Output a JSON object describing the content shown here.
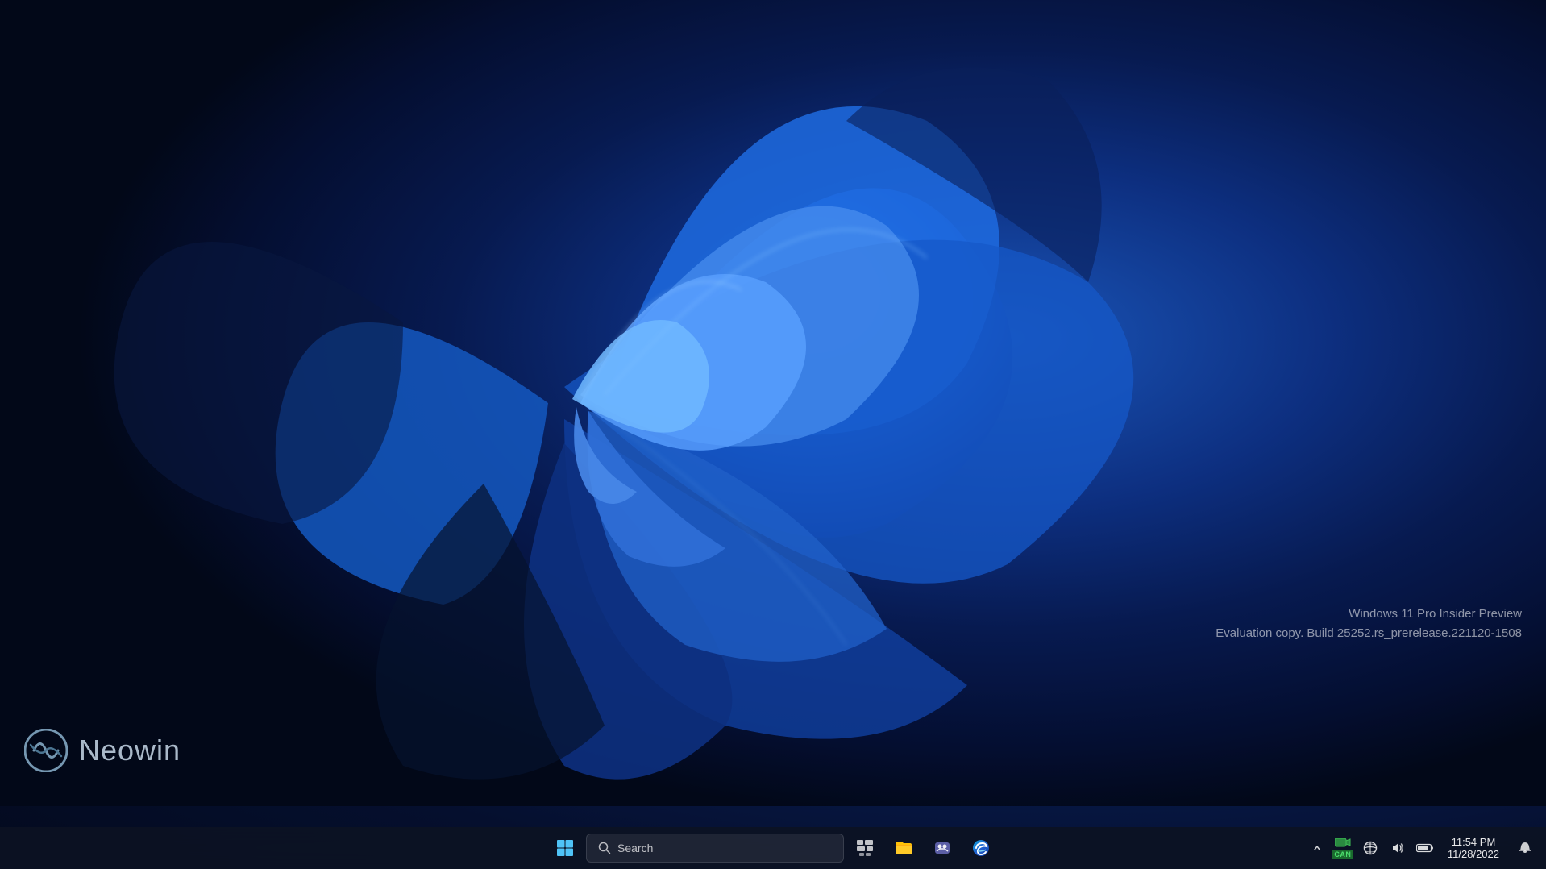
{
  "desktop": {
    "background_primary": "#071a4a",
    "background_secondary": "#030a1e"
  },
  "watermark": {
    "neowin_text": "Neowin",
    "windows_line1": "Windows 11 Pro Insider Preview",
    "windows_line2": "Evaluation copy. Build 25252.rs_prerelease.221120-1508"
  },
  "taskbar": {
    "start_label": "Start",
    "search_placeholder": "Search",
    "search_label": "Search"
  },
  "apps": [
    {
      "name": "task-view",
      "label": "Task View"
    },
    {
      "name": "file-explorer",
      "label": "File Explorer"
    },
    {
      "name": "teams",
      "label": "Microsoft Teams"
    },
    {
      "name": "edge",
      "label": "Microsoft Edge"
    }
  ],
  "system_tray": {
    "chevron_label": "Show hidden icons",
    "network_label": "Network",
    "sound_label": "Sound",
    "battery_label": "Battery",
    "cam_label": "CAM",
    "cam_badge": "CAN",
    "notifications_label": "Notifications"
  },
  "clock": {
    "time": "11:54 PM",
    "date": "11/28/2022"
  }
}
